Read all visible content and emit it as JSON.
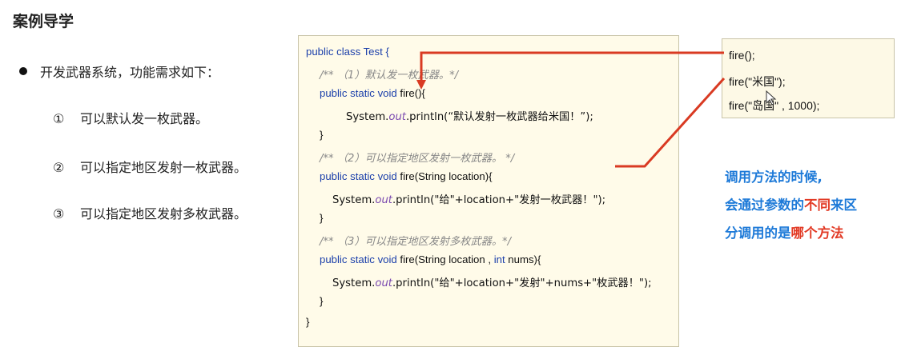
{
  "slide": {
    "title": "案例导学",
    "bullet": "开发武器系统，功能需求如下：",
    "requirements": [
      {
        "num": "①",
        "text": "可以默认发一枚武器。"
      },
      {
        "num": "②",
        "text": "可以指定地区发射一枚武器。"
      },
      {
        "num": "③",
        "text": "可以指定地区发射多枚武器。"
      }
    ]
  },
  "code": {
    "l1": "public class Test {",
    "l2": "/** （1）默认发一枚武器。*/",
    "l3_kw": "public static void",
    "l3_rest": " fire(){",
    "l4_pre": "System.",
    "l4_out": "out",
    "l4_post": ".println(“默认发射一枚武器给米国！”);",
    "l5": "}",
    "l6": "/** （2）可以指定地区发射一枚武器。 */",
    "l7_kw": "public static void",
    "l7_rest": " fire(String location){",
    "l8_pre": "System.",
    "l8_out": "out",
    "l8_post": ".println(\"给\"+location+\"发射一枚武器！\");",
    "l9": "}",
    "l10": "/** （3）可以指定地区发射多枚武器。*/",
    "l11_kw": "public static void",
    "l11_mid": " fire(String location , ",
    "l11_int": "int",
    "l11_rest": " nums){",
    "l12_pre": "System.",
    "l12_out": "out",
    "l12_post": ".println(\"给\"+location+\"发射\"+nums+\"枚武器！\");",
    "l13": "}",
    "l14": "}"
  },
  "calls": [
    "fire();",
    "fire(\"米国\");",
    "fire(\"岛国\" , 1000);"
  ],
  "note": {
    "line1": "调用方法的时候,",
    "line2_a": "会通过参数的",
    "line2_b": "不同",
    "line2_c": "来区",
    "line3_a": "分调用的是",
    "line3_b": "哪个方法"
  },
  "colors": {
    "arrow": "#d93a22",
    "keyword": "#1b3faa",
    "note_blue": "#1e7ad8",
    "note_red": "#e23a25"
  }
}
